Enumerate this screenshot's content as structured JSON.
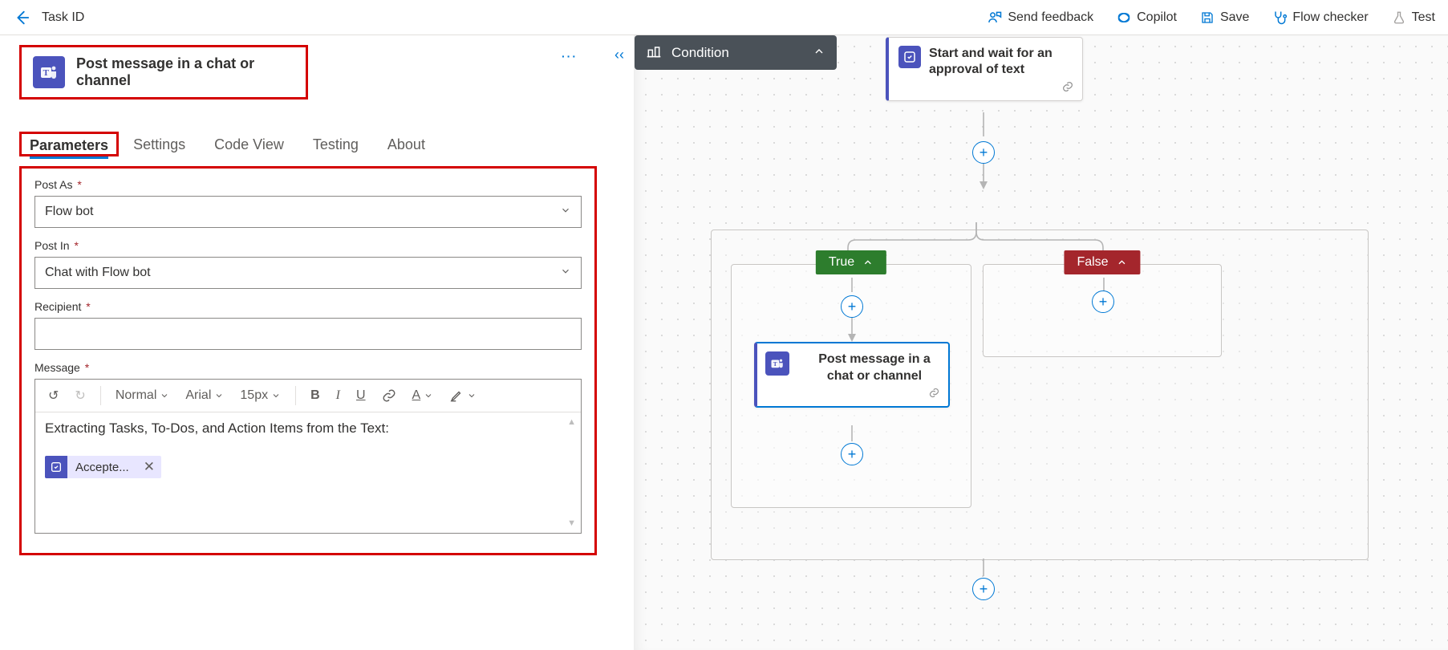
{
  "topbar": {
    "title": "Task ID",
    "actions": {
      "feedback": "Send feedback",
      "copilot": "Copilot",
      "save": "Save",
      "checker": "Flow checker",
      "test": "Test"
    }
  },
  "panel": {
    "action_title": "Post message in a chat or channel",
    "tabs": {
      "parameters": "Parameters",
      "settings": "Settings",
      "codeview": "Code View",
      "testing": "Testing",
      "about": "About"
    },
    "fields": {
      "post_as_label": "Post As",
      "post_as_value": "Flow bot",
      "post_in_label": "Post In",
      "post_in_value": "Chat with Flow bot",
      "recipient_label": "Recipient",
      "recipient_value": "",
      "message_label": "Message"
    },
    "rte": {
      "style": "Normal",
      "font": "Arial",
      "size": "15px",
      "body_text": "Extracting Tasks, To-Dos, and Action Items from the Text:",
      "token_label": "Accepte..."
    }
  },
  "canvas": {
    "approval_title": "Start and wait for an approval of text",
    "condition_label": "Condition",
    "true_label": "True",
    "false_label": "False",
    "post_node_title": "Post message in a chat or channel"
  }
}
